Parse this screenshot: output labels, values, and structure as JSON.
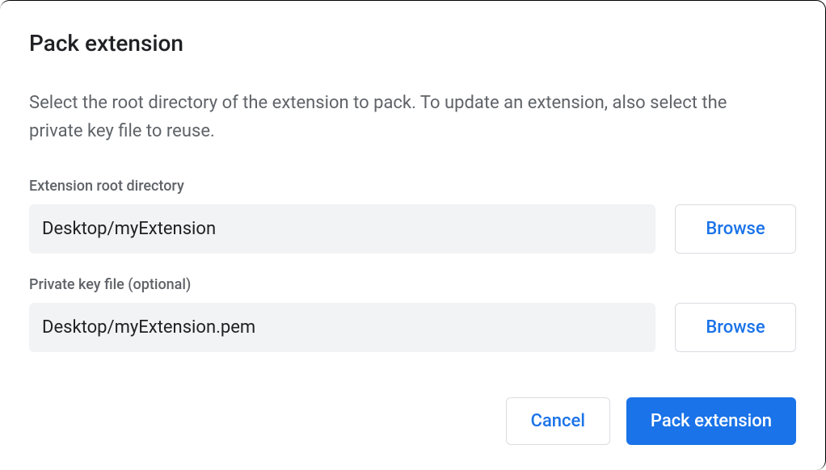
{
  "dialog": {
    "title": "Pack extension",
    "description": "Select the root directory of the extension to pack. To update an extension, also select the private key file to reuse.",
    "fields": {
      "rootDir": {
        "label": "Extension root directory",
        "value": "Desktop/myExtension",
        "browse": "Browse"
      },
      "privateKey": {
        "label": "Private key file (optional)",
        "value": "Desktop/myExtension.pem",
        "browse": "Browse"
      }
    },
    "actions": {
      "cancel": "Cancel",
      "pack": "Pack extension"
    }
  }
}
